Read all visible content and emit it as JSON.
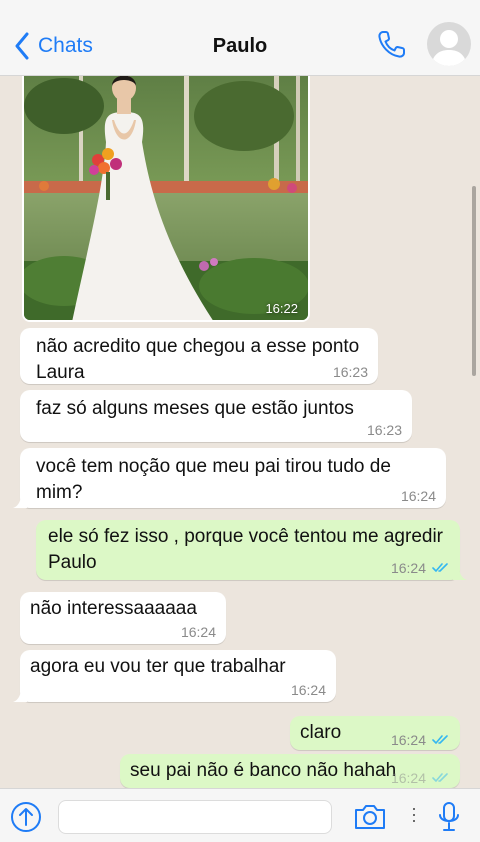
{
  "header": {
    "back_label": "Chats",
    "contact_name": "Paulo"
  },
  "photo_message": {
    "time": "16:22"
  },
  "messages": [
    {
      "text": "não acredito que chegou a esse ponto Laura",
      "time": "16:23",
      "direction": "in"
    },
    {
      "text": "faz só alguns meses que estão juntos",
      "time": "16:23",
      "direction": "in"
    },
    {
      "text": "você tem noção que meu pai tirou tudo de mim?",
      "time": "16:24",
      "direction": "in"
    },
    {
      "text": "ele só fez isso , porque você tentou me agredir Paulo",
      "time": "16:24",
      "direction": "out",
      "status": "read"
    },
    {
      "text": "não interessaaaaaa",
      "time": "16:24",
      "direction": "in"
    },
    {
      "text": "agora eu vou ter que trabalhar",
      "time": "16:24",
      "direction": "in"
    },
    {
      "text": "claro",
      "time": "16:24",
      "direction": "out",
      "status": "read"
    },
    {
      "text": "seu pai não é banco não hahah",
      "time": "16:24",
      "direction": "out",
      "status": "read"
    }
  ],
  "colors": {
    "accent": "#1f7cf6",
    "outgoing_bubble": "#dcf8c6",
    "incoming_bubble": "#ffffff",
    "chat_bg": "#ece5dd",
    "read_ticks": "#34b7f1"
  },
  "icons": [
    "chevron-left-icon",
    "phone-icon",
    "avatar-icon",
    "send-arrow-up-icon",
    "camera-icon",
    "mic-icon"
  ]
}
